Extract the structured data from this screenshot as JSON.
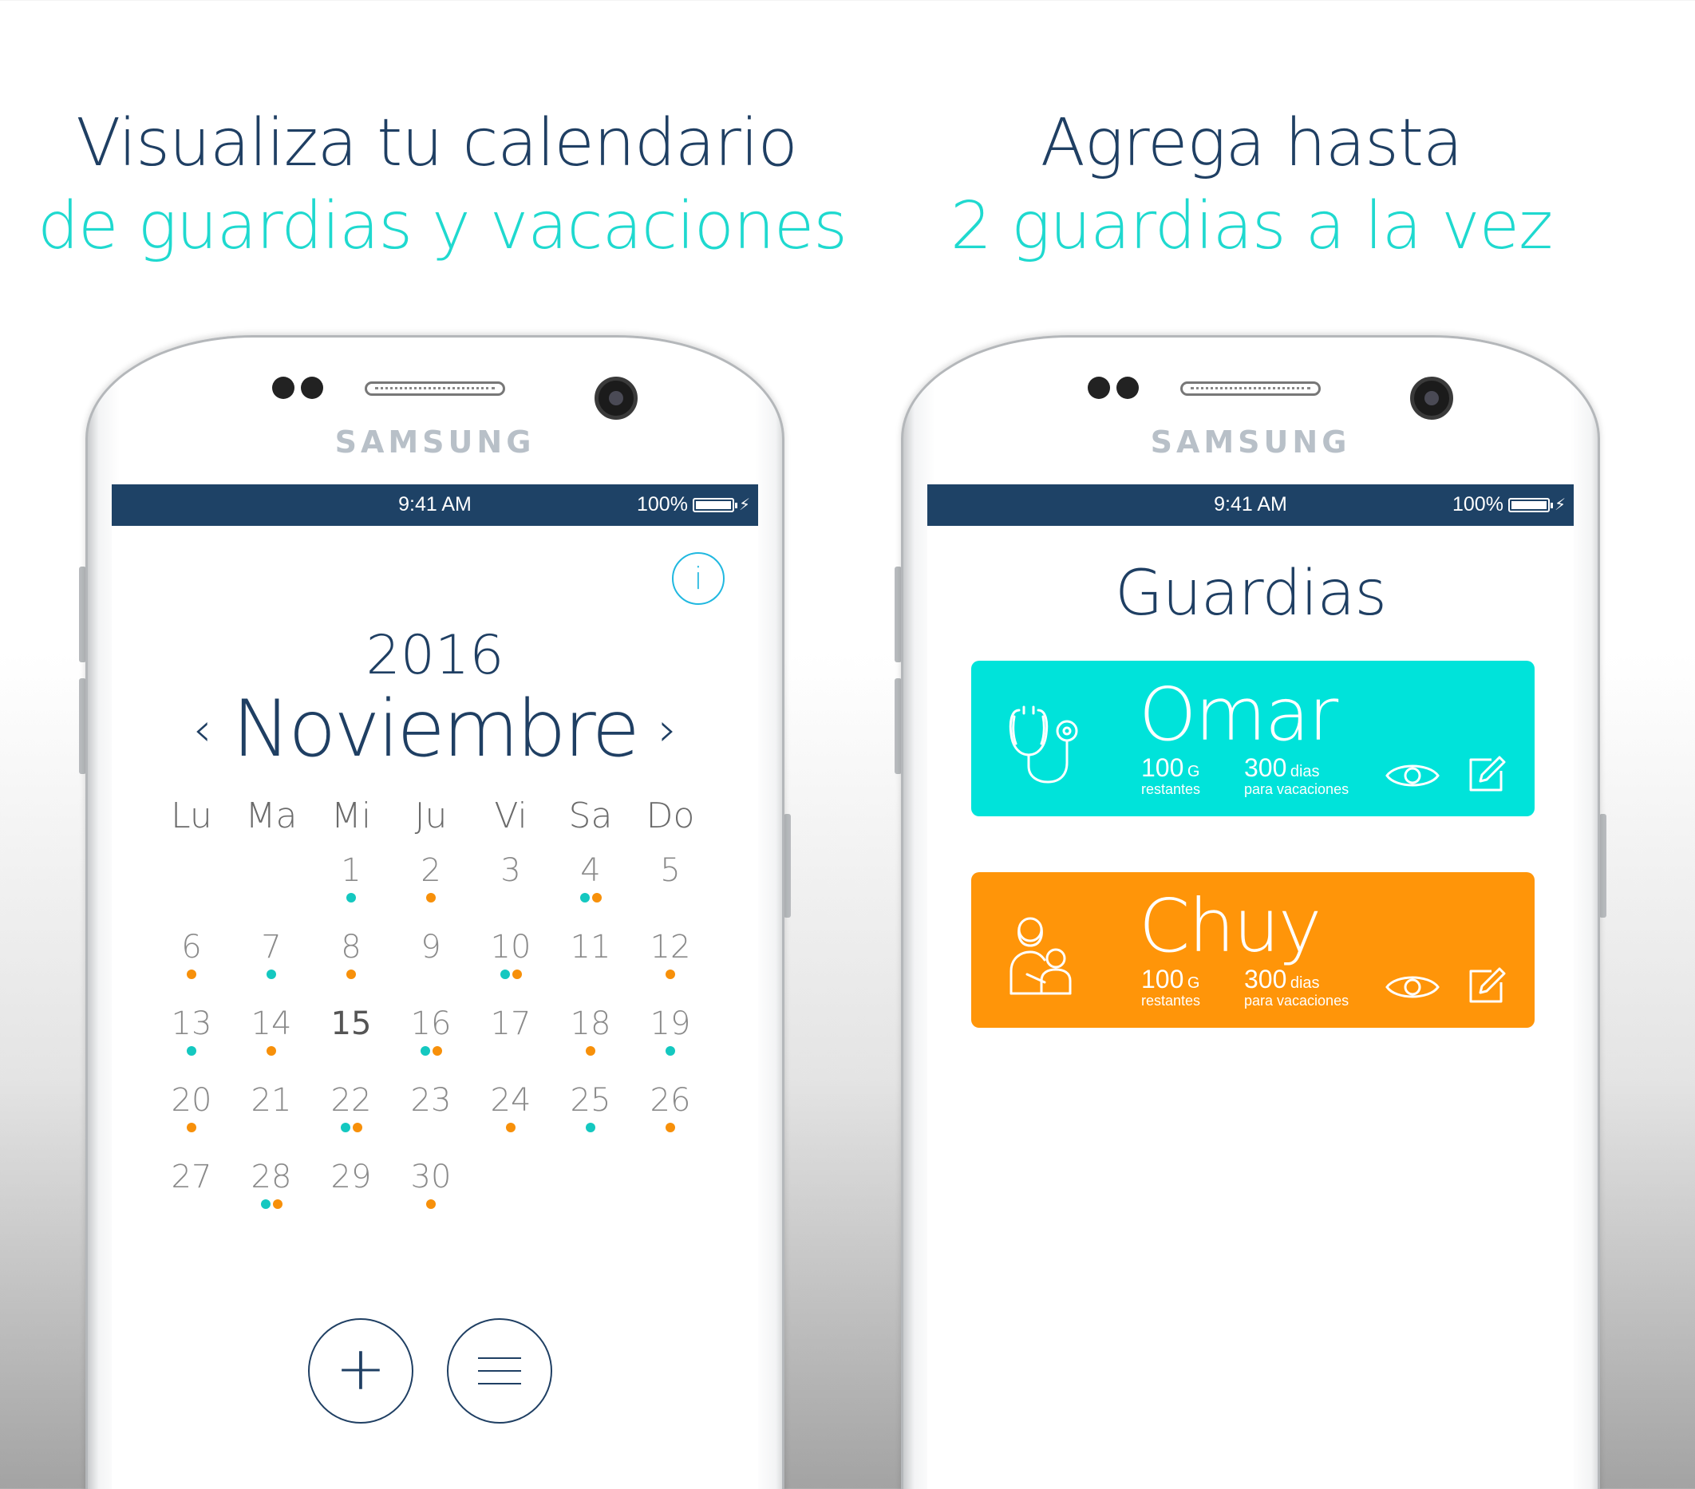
{
  "headline_left": {
    "line1": "Visualiza tu calendario",
    "line2": "de guardias y vacaciones"
  },
  "headline_right": {
    "line1": "Agrega hasta",
    "line2": "2 guardias a la vez"
  },
  "device": {
    "brand": "SAMSUNG"
  },
  "status_bar": {
    "time": "9:41 AM",
    "battery": "100%"
  },
  "calendar": {
    "info_label": "i",
    "year": "2016",
    "month": "Noviembre",
    "prev_label": "‹",
    "next_label": "›",
    "weekdays": [
      "Lu",
      "Ma",
      "Mi",
      "Ju",
      "Vi",
      "Sa",
      "Do"
    ],
    "today": "15",
    "weeks": [
      [
        {
          "d": "",
          "dots": []
        },
        {
          "d": "",
          "dots": []
        },
        {
          "d": "1",
          "dots": [
            "teal"
          ]
        },
        {
          "d": "2",
          "dots": [
            "orange"
          ]
        },
        {
          "d": "3",
          "dots": []
        },
        {
          "d": "4",
          "dots": [
            "teal",
            "orange"
          ]
        },
        {
          "d": "5",
          "dots": []
        }
      ],
      [
        {
          "d": "6",
          "dots": [
            "orange"
          ]
        },
        {
          "d": "7",
          "dots": [
            "teal"
          ]
        },
        {
          "d": "8",
          "dots": [
            "orange"
          ]
        },
        {
          "d": "9",
          "dots": []
        },
        {
          "d": "10",
          "dots": [
            "teal",
            "orange"
          ]
        },
        {
          "d": "11",
          "dots": []
        },
        {
          "d": "12",
          "dots": [
            "orange"
          ]
        }
      ],
      [
        {
          "d": "13",
          "dots": [
            "teal"
          ]
        },
        {
          "d": "14",
          "dots": [
            "orange"
          ]
        },
        {
          "d": "15",
          "dots": []
        },
        {
          "d": "16",
          "dots": [
            "teal",
            "orange"
          ]
        },
        {
          "d": "17",
          "dots": []
        },
        {
          "d": "18",
          "dots": [
            "orange"
          ]
        },
        {
          "d": "19",
          "dots": [
            "teal"
          ]
        }
      ],
      [
        {
          "d": "20",
          "dots": [
            "orange"
          ]
        },
        {
          "d": "21",
          "dots": []
        },
        {
          "d": "22",
          "dots": [
            "teal",
            "orange"
          ]
        },
        {
          "d": "23",
          "dots": []
        },
        {
          "d": "24",
          "dots": [
            "orange"
          ]
        },
        {
          "d": "25",
          "dots": [
            "teal"
          ]
        },
        {
          "d": "26",
          "dots": [
            "orange"
          ]
        }
      ],
      [
        {
          "d": "27",
          "dots": []
        },
        {
          "d": "28",
          "dots": [
            "teal",
            "orange"
          ]
        },
        {
          "d": "29",
          "dots": []
        },
        {
          "d": "30",
          "dots": [
            "orange"
          ]
        },
        {
          "d": "",
          "dots": []
        },
        {
          "d": "",
          "dots": []
        },
        {
          "d": "",
          "dots": []
        }
      ]
    ],
    "add_label": "+",
    "icons": {
      "info": "info-icon",
      "add": "plus-icon",
      "menu": "hamburger-menu-icon"
    }
  },
  "guardias": {
    "title": "Guardias",
    "cards": [
      {
        "name": "Omar",
        "color": "#00e3da",
        "icon": "stethoscope-icon",
        "g_value": "100",
        "g_unit": "G",
        "g_sub": "restantes",
        "dias_value": "300",
        "dias_unit": "dias",
        "dias_sub": "para vacaciones"
      },
      {
        "name": "Chuy",
        "color": "#ff9509",
        "icon": "mother-baby-icon",
        "g_value": "100",
        "g_unit": "G",
        "g_sub": "restantes",
        "dias_value": "300",
        "dias_unit": "dias",
        "dias_sub": "para vacaciones"
      }
    ]
  },
  "colors": {
    "navy": "#1f3f63",
    "teal": "#14c8c0",
    "orange": "#f7900a",
    "status_bar": "#1e4266"
  }
}
